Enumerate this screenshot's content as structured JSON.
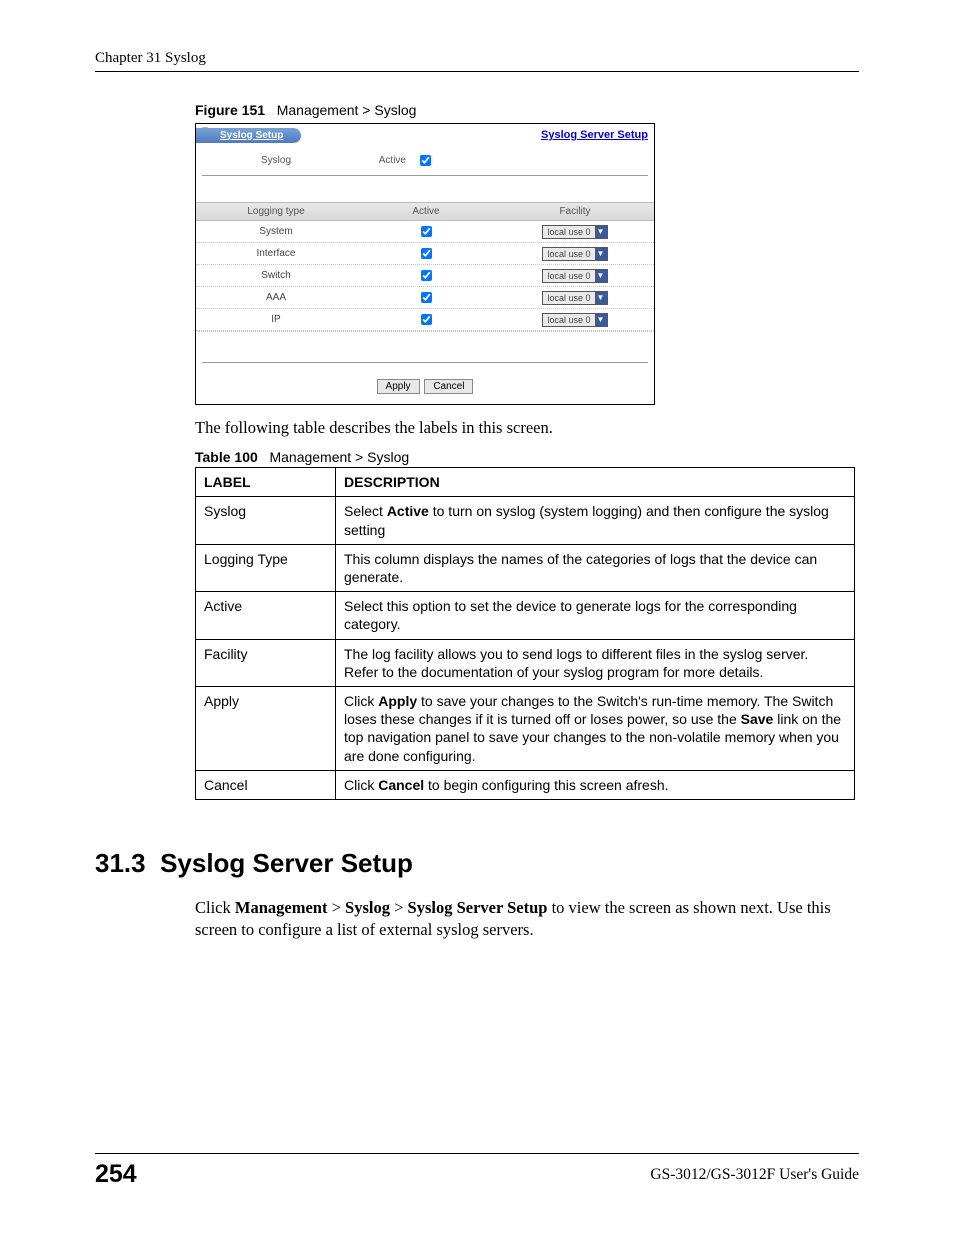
{
  "header": {
    "chapter": "Chapter 31 Syslog"
  },
  "figure": {
    "num": "Figure 151",
    "title": "Management > Syslog"
  },
  "shot": {
    "tab_title": "Syslog Setup",
    "server_link": "Syslog Server Setup",
    "syslog_label": "Syslog",
    "active_label": "Active",
    "thead": {
      "c1": "Logging type",
      "c2": "Active",
      "c3": "Facility"
    },
    "rows": [
      {
        "name": "System",
        "facility": "local use 0"
      },
      {
        "name": "Interface",
        "facility": "local use 0"
      },
      {
        "name": "Switch",
        "facility": "local use 0"
      },
      {
        "name": "AAA",
        "facility": "local use 0"
      },
      {
        "name": "IP",
        "facility": "local use 0"
      }
    ],
    "apply": "Apply",
    "cancel": "Cancel"
  },
  "intro_text": "The following table describes the labels in this screen.",
  "table_caption": {
    "num": "Table 100",
    "title": "Management > Syslog"
  },
  "table": {
    "head": {
      "label": "LABEL",
      "desc": "DESCRIPTION"
    },
    "rows": [
      {
        "label": "Syslog",
        "pre": "Select ",
        "b1": "Active",
        "post": " to turn on syslog (system logging) and then configure the syslog setting"
      },
      {
        "label": "Logging Type",
        "pre": "This column displays the names of the categories of logs that the device can generate."
      },
      {
        "label": "Active",
        "pre": "Select this option to set the device to generate logs for the corresponding category."
      },
      {
        "label": "Facility",
        "pre": "The log facility allows you to send logs to different files in the syslog server. Refer to the documentation of your syslog program for more details."
      },
      {
        "label": "Apply",
        "pre": "Click ",
        "b1": "Apply",
        "mid": " to save your changes to the Switch's run-time memory. The Switch loses these changes if it is turned off or loses power, so use the ",
        "b2": "Save",
        "post": " link on the top navigation panel to save your changes to the non-volatile memory when you are done configuring."
      },
      {
        "label": "Cancel",
        "pre": "Click ",
        "b1": "Cancel",
        "post": " to begin configuring this screen afresh."
      }
    ]
  },
  "section": {
    "num": "31.3",
    "title": "Syslog Server Setup",
    "para_pre": "Click ",
    "para_b1": "Management",
    "para_gt1": " > ",
    "para_b2": "Syslog",
    "para_gt2": " > ",
    "para_b3": "Syslog Server Setup",
    "para_post": " to view the screen as shown next. Use this screen to configure a list of external syslog servers."
  },
  "footer": {
    "page": "254",
    "guide": "GS-3012/GS-3012F User's Guide"
  }
}
